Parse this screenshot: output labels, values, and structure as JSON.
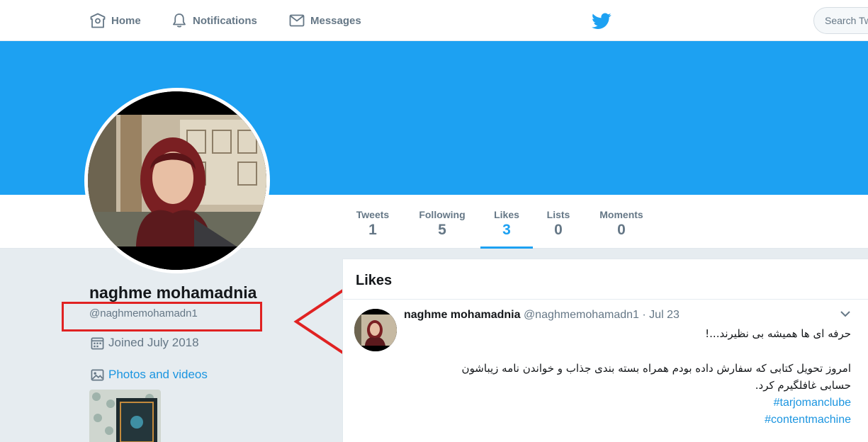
{
  "nav": {
    "home": "Home",
    "notifications": "Notifications",
    "messages": "Messages",
    "search_placeholder": "Search Tw"
  },
  "colors": {
    "brand": "#1da1f2",
    "link": "#1b95e0",
    "annotation": "#e02222"
  },
  "profile_nav": {
    "stats": [
      {
        "label": "Tweets",
        "value": "1"
      },
      {
        "label": "Following",
        "value": "5"
      },
      {
        "label": "Likes",
        "value": "3"
      },
      {
        "label": "Lists",
        "value": "0"
      },
      {
        "label": "Moments",
        "value": "0"
      }
    ],
    "active": "Likes"
  },
  "profile": {
    "name": "naghme mohamadnia",
    "handle": "@naghmemohamadn1",
    "joined": "Joined July 2018",
    "photos_link": "Photos and videos"
  },
  "timeline": {
    "title": "Likes",
    "tweet": {
      "name": "naghme mohamadnia",
      "meta": "@naghmemohamadn1 · Jul 23",
      "line1": "حرفه ای ها همیشه بی نظیرند...!",
      "line2": "امروز تحویل کتابی که سفارش داده بودم همراه بسته بندی جذاب و خواندن نامه زیباشون",
      "line3": "حسابی غافلگیرم کرد.",
      "hashtags": [
        "#tarjomanclube",
        "#contentmachine"
      ]
    }
  },
  "icons": [
    "home-icon",
    "bell-icon",
    "envelope-icon",
    "twitter-bird-icon",
    "calendar-icon",
    "image-icon",
    "chevron-down-icon"
  ]
}
